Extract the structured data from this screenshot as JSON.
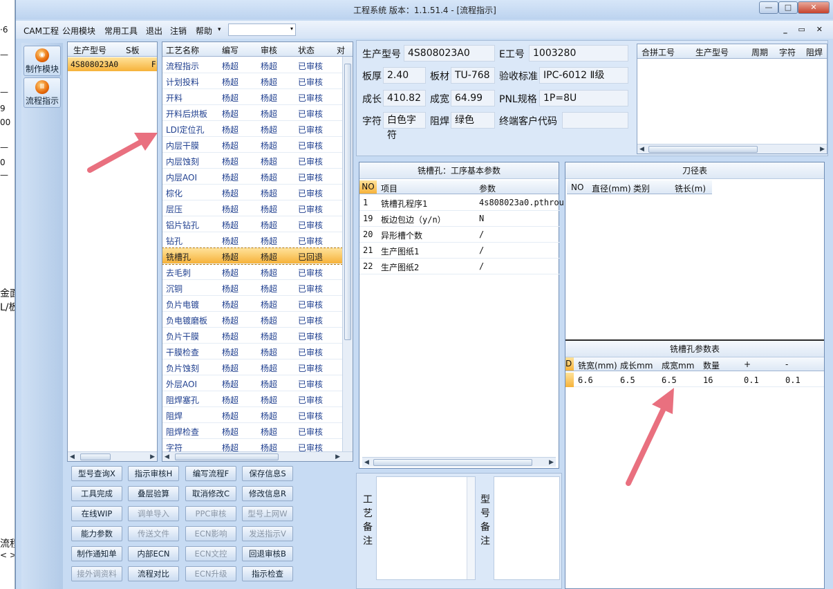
{
  "title": "工程系统  版本：1.1.51.4 - [流程指示]",
  "window_controls": {
    "min": "—",
    "max": "□",
    "close": "✕"
  },
  "left_strip": [
    "·6",
    "—",
    "—",
    "9",
    "00",
    "—",
    "0",
    "—",
    "金面",
    "L/板",
    "流程",
    "< >"
  ],
  "menu": [
    "CAM工程",
    "公用模块",
    "常用工具",
    "退出",
    "注销",
    "帮助"
  ],
  "menu_caret": "▾",
  "mdi_controls": "_ ▭ ✕",
  "nav": [
    {
      "label": "制作模块",
      "icon": "orb-icon",
      "glyph": "◉"
    },
    {
      "label": "流程指示",
      "icon": "orb-icon",
      "glyph": "Ⅲ"
    }
  ],
  "model_list": {
    "headers": [
      "生产型号",
      "S板"
    ],
    "rows": [
      {
        "model": "4S808023A0",
        "flag": "F"
      }
    ]
  },
  "process": {
    "headers": [
      "工艺名称",
      "编写",
      "审核",
      "状态",
      "对"
    ],
    "rows": [
      [
        "流程指示",
        "杨超",
        "杨超",
        "已审核"
      ],
      [
        "计划投料",
        "杨超",
        "杨超",
        "已审核"
      ],
      [
        "开料",
        "杨超",
        "杨超",
        "已审核"
      ],
      [
        "开料后烘板",
        "杨超",
        "杨超",
        "已审核"
      ],
      [
        "LDI定位孔",
        "杨超",
        "杨超",
        "已审核"
      ],
      [
        "内层干膜",
        "杨超",
        "杨超",
        "已审核"
      ],
      [
        "内层蚀刻",
        "杨超",
        "杨超",
        "已审核"
      ],
      [
        "内层AOI",
        "杨超",
        "杨超",
        "已审核"
      ],
      [
        "棕化",
        "杨超",
        "杨超",
        "已审核"
      ],
      [
        "层压",
        "杨超",
        "杨超",
        "已审核"
      ],
      [
        "铝片钻孔",
        "杨超",
        "杨超",
        "已审核"
      ],
      [
        "钻孔",
        "杨超",
        "杨超",
        "已审核"
      ],
      [
        "铣槽孔",
        "杨超",
        "杨超",
        "已回退"
      ],
      [
        "去毛刺",
        "杨超",
        "杨超",
        "已审核"
      ],
      [
        "沉铜",
        "杨超",
        "杨超",
        "已审核"
      ],
      [
        "负片电镀",
        "杨超",
        "杨超",
        "已审核"
      ],
      [
        "负电镀磨板",
        "杨超",
        "杨超",
        "已审核"
      ],
      [
        "负片干膜",
        "杨超",
        "杨超",
        "已审核"
      ],
      [
        "干膜检查",
        "杨超",
        "杨超",
        "已审核"
      ],
      [
        "负片蚀刻",
        "杨超",
        "杨超",
        "已审核"
      ],
      [
        "外层AOI",
        "杨超",
        "杨超",
        "已审核"
      ],
      [
        "阻焊塞孔",
        "杨超",
        "杨超",
        "已审核"
      ],
      [
        "阻焊",
        "杨超",
        "杨超",
        "已审核"
      ],
      [
        "阻焊检查",
        "杨超",
        "杨超",
        "已审核"
      ],
      [
        "字符",
        "杨超",
        "杨超",
        "已审核"
      ]
    ],
    "selected_index": 12
  },
  "buttons": [
    [
      {
        "t": "型号查询X",
        "d": false
      },
      {
        "t": "指示审核H",
        "d": false
      },
      {
        "t": "编写流程F",
        "d": false
      },
      {
        "t": "保存信息S",
        "d": false
      }
    ],
    [
      {
        "t": "工具完成",
        "d": false
      },
      {
        "t": "叠层验算",
        "d": false
      },
      {
        "t": "取消修改C",
        "d": false
      },
      {
        "t": "修改信息R",
        "d": false
      }
    ],
    [
      {
        "t": "在线WIP",
        "d": false
      },
      {
        "t": "调单导入",
        "d": true
      },
      {
        "t": "PPC审核",
        "d": true
      },
      {
        "t": "型号上网W",
        "d": true
      }
    ],
    [
      {
        "t": "能力参数",
        "d": false
      },
      {
        "t": "传送文件",
        "d": true
      },
      {
        "t": "ECN影响",
        "d": true
      },
      {
        "t": "发送指示V",
        "d": true
      }
    ],
    [
      {
        "t": "制作通知单",
        "d": false
      },
      {
        "t": "内部ECN",
        "d": false
      },
      {
        "t": "ECN文控",
        "d": true
      },
      {
        "t": "回退审核B",
        "d": false
      }
    ],
    [
      {
        "t": "接外调资料",
        "d": true
      },
      {
        "t": "流程对比",
        "d": false
      },
      {
        "t": "ECN升级",
        "d": true
      },
      {
        "t": "指示检查",
        "d": false
      }
    ]
  ],
  "info": {
    "model_label": "生产型号",
    "model": "4S808023A0",
    "e_label": "E工号",
    "e_no": "1003280",
    "thick_label": "板厚",
    "thick": "2.40",
    "mat_label": "板材",
    "mat": "TU-768",
    "std_label": "验收标准",
    "std": "IPC-6012 Ⅱ级",
    "len_label": "成长",
    "len": "410.82",
    "wid_label": "成宽",
    "wid": "64.99",
    "pnl_label": "PNL规格",
    "pnl": "1P=8U",
    "char_label": "字符",
    "char": "白色字符",
    "mask_label": "阻焊",
    "mask": "绿色",
    "cust_label": "终端客户代码",
    "cust": ""
  },
  "combine": {
    "headers": [
      "合拼工号",
      "生产型号",
      "周期",
      "字符",
      "阻焊"
    ]
  },
  "mill": {
    "title": "铣槽孔：工序基本参数",
    "headers": [
      "NO",
      "项目",
      "参数"
    ],
    "rows": [
      [
        "1",
        "铣槽孔程序1",
        "4s808023a0.pthrou"
      ],
      [
        "19",
        "板边包边（y/n）",
        "N"
      ],
      [
        "20",
        "异形槽个数",
        "/"
      ],
      [
        "21",
        "生产图纸1",
        "/"
      ],
      [
        "22",
        "生产图纸2",
        "/"
      ]
    ]
  },
  "knife": {
    "title": "刀径表",
    "headers": [
      "NO",
      "直径(mm)",
      "类别",
      "铣长(m)"
    ]
  },
  "slot": {
    "title": "铣槽孔参数表",
    "headers": [
      "D",
      "铣宽(mm)",
      "成长mm",
      "成宽mm",
      "数量",
      "+",
      "-"
    ],
    "rows": [
      [
        "",
        "6.6",
        "6.5",
        "6.5",
        "16",
        "0.1",
        "0.1"
      ]
    ]
  },
  "memo": {
    "proc_label": "工艺备注",
    "model_label": "型号备注"
  },
  "colors": {
    "accent": "#f6b23a",
    "arrow": "#e9707f",
    "link": "#1f3f8f"
  }
}
